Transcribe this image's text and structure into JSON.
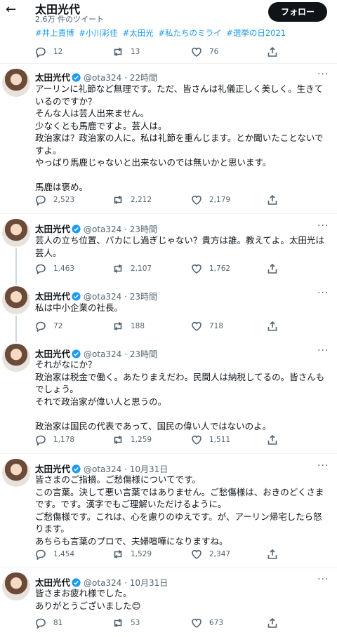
{
  "header": {
    "name": "太田光代",
    "tweet_count": "2.6万 件のツイート",
    "follow_label": "フォロー"
  },
  "top": {
    "hashtags": [
      "#井上貴博",
      "#小川彩佳",
      "#太田光",
      "#私たちのミライ",
      "#選挙の日2021"
    ],
    "replies": "12",
    "retweets": "13",
    "likes": "76"
  },
  "tweets": [
    {
      "name": "太田光代",
      "handle": "@ota324 · 22時間",
      "body": "アーリンに礼節など無理です。ただ、皆さんは礼儀正しく美しく。生きているのですか？\nそんな人は芸人出来ません。\n少なくとも馬鹿ですよ。芸人は。\n政治家は？政治家の人に。私は礼節を重んじます。とか聞いたことないですよ。\nやっぱり馬鹿じゃないと出来ないのでは無いかと思います。\n\n馬鹿は褒め。",
      "replies": "2,523",
      "retweets": "2,212",
      "likes": "2,179"
    },
    {
      "name": "太田光代",
      "handle": "@ota324 · 23時間",
      "body": "芸人の立ち位置、バカにし過ぎじゃない？貴方は誰。教えてよ。太田光は芸人。",
      "replies": "1,463",
      "retweets": "2,107",
      "likes": "1,762"
    },
    {
      "name": "太田光代",
      "handle": "@ota324 · 23時間",
      "body": "私は中小企業の社長。",
      "replies": "72",
      "retweets": "188",
      "likes": "718"
    },
    {
      "name": "太田光代",
      "handle": "@ota324 · 23時間",
      "body": "それがなにか？\n政治家は税金で働く。あたりまえだわ。民間人は納税してるの。皆さんもでしょう。\nそれで政治家が偉い人と思うの。\n\n政治家は国民の代表であって、国民の偉い人ではないのよ。",
      "replies": "1,178",
      "retweets": "1,259",
      "likes": "1,511"
    },
    {
      "name": "太田光代",
      "handle": "@ota324 · 10月31日",
      "body": "皆さまのご指摘。ご愁傷様についてです。\nこの言葉。決して悪い言葉ではありません。ご愁傷様は、おきのどくさまです。です。漢字でもご理解いただけるように。\nご愁傷様です。これは、心を慮りのゆえです。が、アーリン帰宅したら怒ります。\nあちらも言葉のプロで、夫婦喧嘩になりますね。",
      "replies": "1,454",
      "retweets": "1,529",
      "likes": "2,347"
    },
    {
      "name": "太田光代",
      "handle": "@ota324 · 10月31日",
      "body": "皆さまお疲れ様でした。\nありがとうございました😊",
      "replies": "81",
      "retweets": "53",
      "likes": "673"
    }
  ],
  "icons": {
    "back": "arrow-left-icon",
    "verified": "verified-badge-icon",
    "reply": "reply-icon",
    "retweet": "retweet-icon",
    "like": "heart-icon",
    "share": "share-icon",
    "more": "more-icon"
  },
  "colors": {
    "accent": "#1d9bf0",
    "text": "#0f1419",
    "muted": "#536471",
    "thread_line": "#cfd9de"
  }
}
